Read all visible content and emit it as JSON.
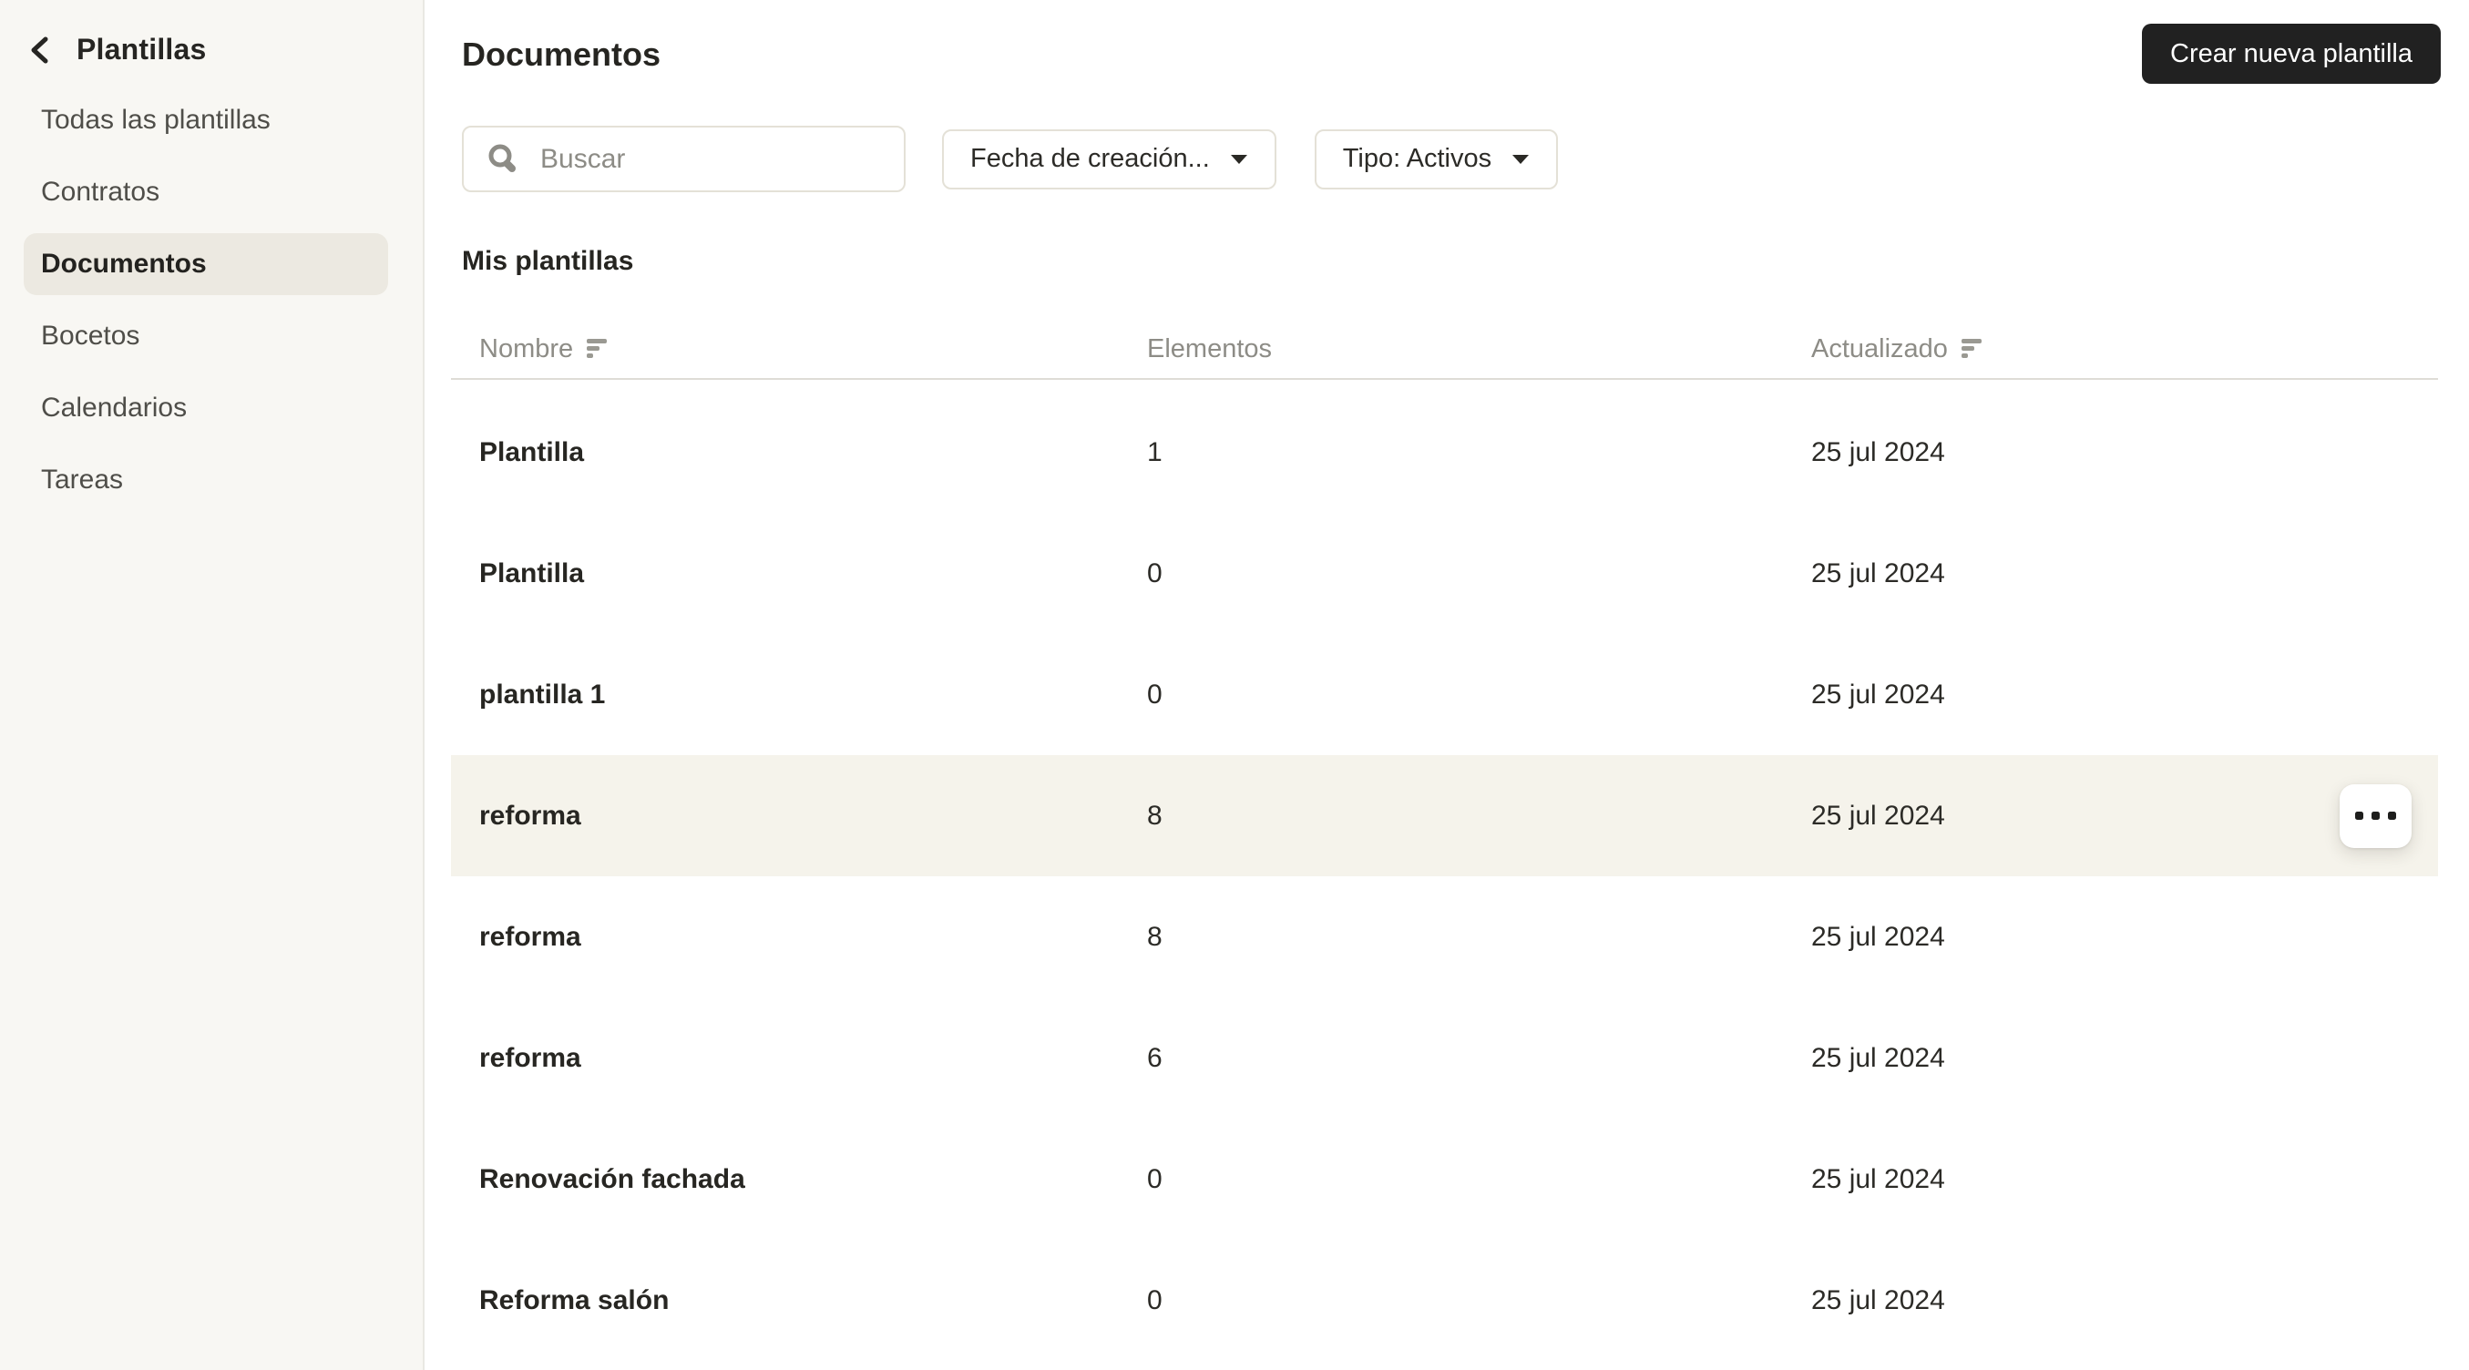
{
  "sidebar": {
    "back_label": "Plantillas",
    "items": [
      {
        "label": "Todas las plantillas",
        "selected": false
      },
      {
        "label": "Contratos",
        "selected": false
      },
      {
        "label": "Documentos",
        "selected": true
      },
      {
        "label": "Bocetos",
        "selected": false
      },
      {
        "label": "Calendarios",
        "selected": false
      },
      {
        "label": "Tareas",
        "selected": false
      }
    ]
  },
  "header": {
    "title": "Documentos",
    "create_button_label": "Crear nueva plantilla"
  },
  "filters": {
    "search_placeholder": "Buscar",
    "date_filter_label": "Fecha de creación...",
    "type_filter_label": "Tipo: Activos"
  },
  "section_title": "Mis plantillas",
  "table": {
    "columns": [
      {
        "label": "Nombre",
        "sortable": true
      },
      {
        "label": "Elementos",
        "sortable": false
      },
      {
        "label": "Actualizado",
        "sortable": true
      }
    ],
    "rows": [
      {
        "name": "Plantilla",
        "elements": "1",
        "updated": "25 jul 2024",
        "highlighted": false
      },
      {
        "name": "Plantilla",
        "elements": "0",
        "updated": "25 jul 2024",
        "highlighted": false
      },
      {
        "name": "plantilla 1",
        "elements": "0",
        "updated": "25 jul 2024",
        "highlighted": false
      },
      {
        "name": "reforma",
        "elements": "8",
        "updated": "25 jul 2024",
        "highlighted": true
      },
      {
        "name": "reforma",
        "elements": "8",
        "updated": "25 jul 2024",
        "highlighted": false
      },
      {
        "name": "reforma",
        "elements": "6",
        "updated": "25 jul 2024",
        "highlighted": false
      },
      {
        "name": "Renovación fachada",
        "elements": "0",
        "updated": "25 jul 2024",
        "highlighted": false
      },
      {
        "name": "Reforma salón",
        "elements": "0",
        "updated": "25 jul 2024",
        "highlighted": false
      }
    ],
    "row_menu_icon": "ellipsis-icon"
  },
  "icons": {
    "back": "chevron-left-icon",
    "search": "search-icon",
    "dropdown": "chevron-down-icon",
    "sort": "sort-bars-icon"
  },
  "colors": {
    "sidebar_bg": "#f8f7f3",
    "sidebar_selected_bg": "#ece9e1",
    "main_bg": "#ffffff",
    "primary_text": "#262521",
    "secondary_text": "#8d8c86",
    "dark_button_bg": "#212121",
    "dark_button_text": "#ffffff",
    "highlight_row_bg": "#f5f3eb",
    "border": "#e4e1d7",
    "table_divider": "#dedcd6"
  }
}
